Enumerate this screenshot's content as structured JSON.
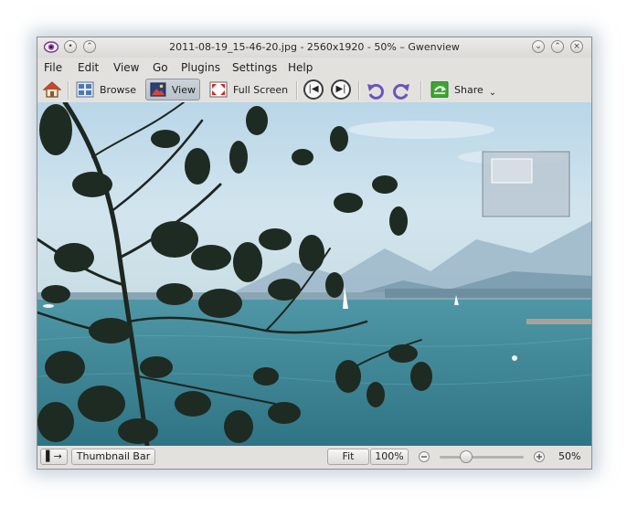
{
  "window": {
    "title": "2011-08-19_15-46-20.jpg - 2560x1920 - 50% – Gwenview"
  },
  "menu": [
    "File",
    "Edit",
    "View",
    "Go",
    "Plugins",
    "Settings",
    "Help"
  ],
  "toolbar": {
    "browse_label": "Browse",
    "view_label": "View",
    "fullscreen_label": "Full Screen",
    "share_label": "Share",
    "share_arrow": "⌄"
  },
  "statusbar": {
    "toggle_sidebar_glyph": "▌→",
    "thumbnail_bar_label": "Thumbnail Bar",
    "fit_label": "Fit",
    "zoom_100_label": "100%",
    "zoom_value": "50%",
    "zoom_slider_fraction": 0.28
  },
  "colors": {
    "accent_active": "#b9c1ca",
    "share_green": "#3fa535",
    "sky": "#c5dde9",
    "water": "#3f8593"
  },
  "icons": [
    "app-eye-icon",
    "home-icon",
    "browse-grid-icon",
    "view-image-icon",
    "fullscreen-icon",
    "previous-icon",
    "next-icon",
    "rotate-left-icon",
    "rotate-right-icon",
    "share-icon",
    "zoom-out-icon",
    "zoom-in-icon"
  ]
}
